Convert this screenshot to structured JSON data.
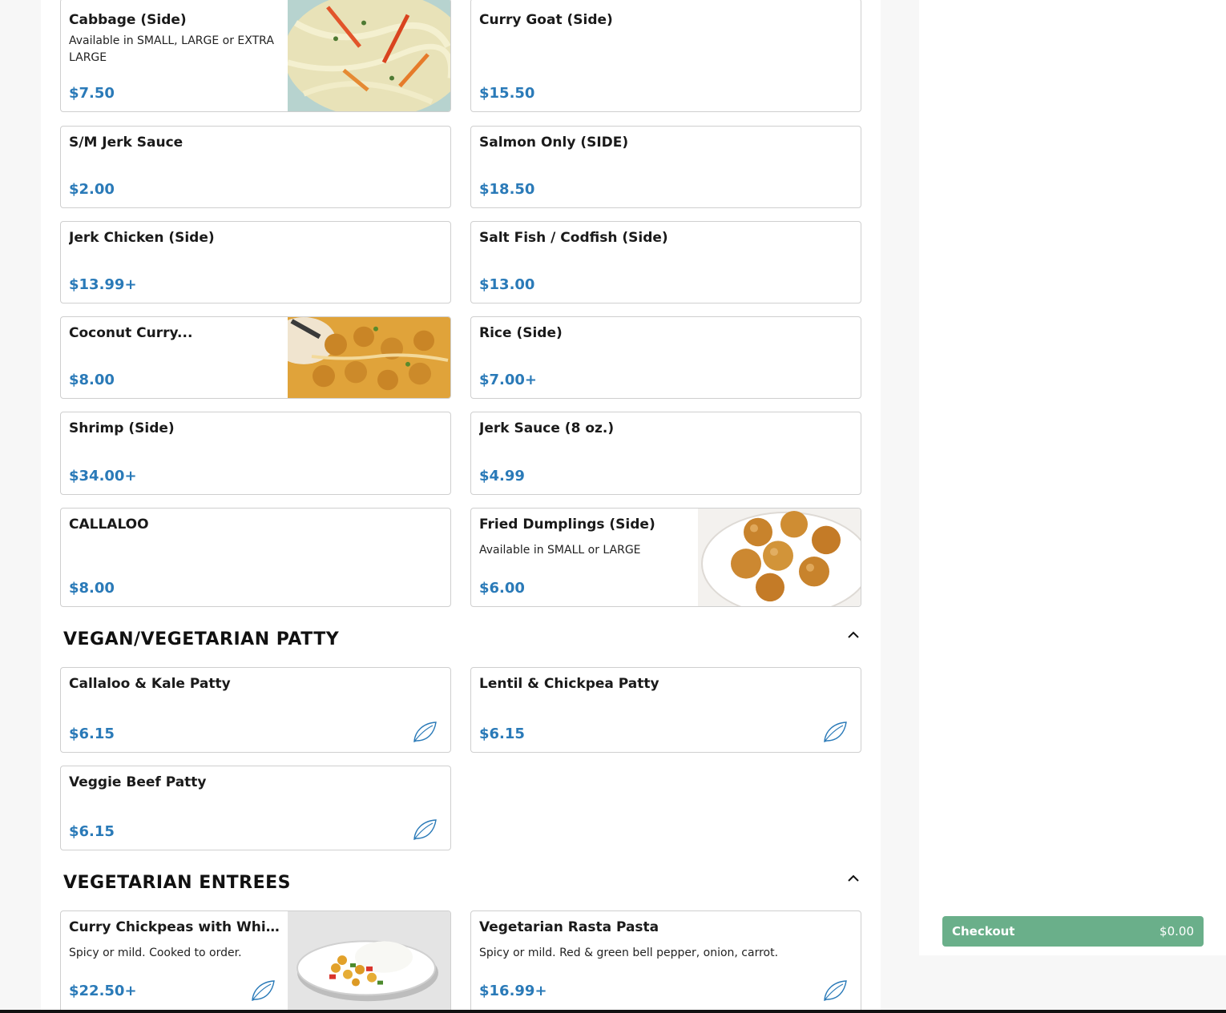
{
  "sections": {
    "vegan_patty_title": "VEGAN/VEGETARIAN PATTY",
    "veg_entrees_title": "VEGETARIAN ENTREES"
  },
  "items": {
    "cabbage": {
      "name": "Cabbage (Side)",
      "desc": "Available in SMALL, LARGE or EXTRA LARGE",
      "price": "$7.50"
    },
    "curry_goat": {
      "name": "Curry Goat (Side)",
      "price": "$15.50"
    },
    "sm_jerk_sauce": {
      "name": "S/M Jerk Sauce",
      "price": "$2.00"
    },
    "salmon_only": {
      "name": "Salmon Only (SIDE)",
      "price": "$18.50"
    },
    "jerk_chicken": {
      "name": "Jerk Chicken (Side)",
      "price": "$13.99+"
    },
    "salt_fish": {
      "name": "Salt Fish / Codfish (Side)",
      "price": "$13.00"
    },
    "coconut_curry": {
      "name": "Coconut Curry...",
      "price": "$8.00"
    },
    "rice": {
      "name": "Rice (Side)",
      "price": "$7.00+"
    },
    "shrimp": {
      "name": "Shrimp (Side)",
      "price": "$34.00+"
    },
    "jerk_sauce_8oz": {
      "name": "Jerk Sauce (8 oz.)",
      "price": "$4.99"
    },
    "callaloo": {
      "name": "CALLALOO",
      "price": "$8.00"
    },
    "fried_dumplings": {
      "name": "Fried Dumplings (Side)",
      "desc": "Available in SMALL or LARGE",
      "price": "$6.00"
    },
    "callaloo_kale_patty": {
      "name": "Callaloo & Kale Patty",
      "price": "$6.15"
    },
    "lentil_chickpea_patty": {
      "name": "Lentil & Chickpea Patty",
      "price": "$6.15"
    },
    "veggie_beef_patty": {
      "name": "Veggie Beef Patty",
      "price": "$6.15"
    },
    "curry_chickpeas": {
      "name": "Curry Chickpeas with Whi...",
      "desc": "Spicy or mild. Cooked to order.",
      "price": "$22.50+"
    },
    "rasta_pasta": {
      "name": "Vegetarian Rasta Pasta",
      "desc": "Spicy or mild. Red & green bell pepper, onion, carrot.",
      "price": "$16.99+"
    }
  },
  "checkout": {
    "label": "Checkout",
    "amount": "$0.00"
  },
  "icons": {
    "vegetarian": "leaf-icon",
    "collapse": "chevron-up-icon"
  },
  "colors": {
    "price": "#2a7ab8",
    "checkout": "#6aaf8a",
    "border": "#cfcfcf"
  }
}
